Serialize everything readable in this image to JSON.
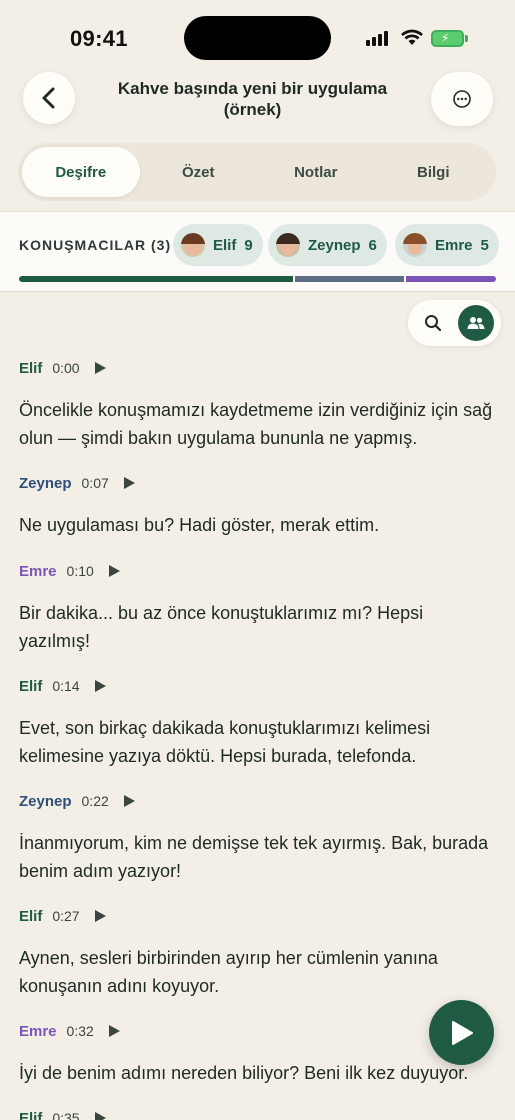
{
  "status_bar": {
    "time": "09:41"
  },
  "header": {
    "title": "Kahve başında yeni bir uygulama (örnek)",
    "back_icon": "chevron-left-icon",
    "more_icon": "ellipsis-circle-icon"
  },
  "tabs": [
    {
      "label": "Deşifre",
      "active": true
    },
    {
      "label": "Özet",
      "active": false
    },
    {
      "label": "Notlar",
      "active": false
    },
    {
      "label": "Bilgi",
      "active": false
    }
  ],
  "speakers": {
    "label": "KONUŞMACILAR (3)",
    "chips": [
      {
        "name": "Elif",
        "count": "9",
        "hair": "#6b3a22"
      },
      {
        "name": "Zeynep",
        "count": "6",
        "hair": "#3b2a20"
      },
      {
        "name": "Emre",
        "count": "5",
        "hair": "#8a4e2a"
      }
    ],
    "share": [
      {
        "speaker": "Elif",
        "fraction": 0.58,
        "color": "#1f5a43"
      },
      {
        "speaker": "Zeynep",
        "fraction": 0.23,
        "color": "#5d6e86"
      },
      {
        "speaker": "Emre",
        "fraction": 0.19,
        "color": "#7c55b8"
      }
    ]
  },
  "colors": {
    "Elif": "#1f5a43",
    "Zeynep": "#2f4f7a",
    "Emre": "#7c55b8",
    "accent": "#1f5a43"
  },
  "transcript": [
    {
      "speaker": "Elif",
      "time": "0:00",
      "text": "Öncelikle konuşmamızı kaydetmeme izin verdiğiniz için sağ olun — şimdi bakın uygulama bununla ne yapmış."
    },
    {
      "speaker": "Zeynep",
      "time": "0:07",
      "text": "Ne uygulaması bu? Hadi göster, merak ettim."
    },
    {
      "speaker": "Emre",
      "time": "0:10",
      "text": "Bir dakika... bu az önce konuştuklarımız mı? Hepsi yazılmış!"
    },
    {
      "speaker": "Elif",
      "time": "0:14",
      "text": "Evet, son birkaç dakikada konuştuklarımızı kelimesi kelimesine yazıya döktü. Hepsi burada, telefonda."
    },
    {
      "speaker": "Zeynep",
      "time": "0:22",
      "text": "İnanmıyorum, kim ne demişse tek tek ayırmış. Bak, burada benim adım yazıyor!"
    },
    {
      "speaker": "Elif",
      "time": "0:27",
      "text": "Aynen, sesleri birbirinden ayırıp her cümlenin yanına konuşanın adını koyuyor."
    },
    {
      "speaker": "Emre",
      "time": "0:32",
      "text": "İyi de benim adımı nereden biliyor? Beni ilk kez duyuyor."
    },
    {
      "speaker": "Elif",
      "time": "0:35",
      "text": ""
    }
  ]
}
